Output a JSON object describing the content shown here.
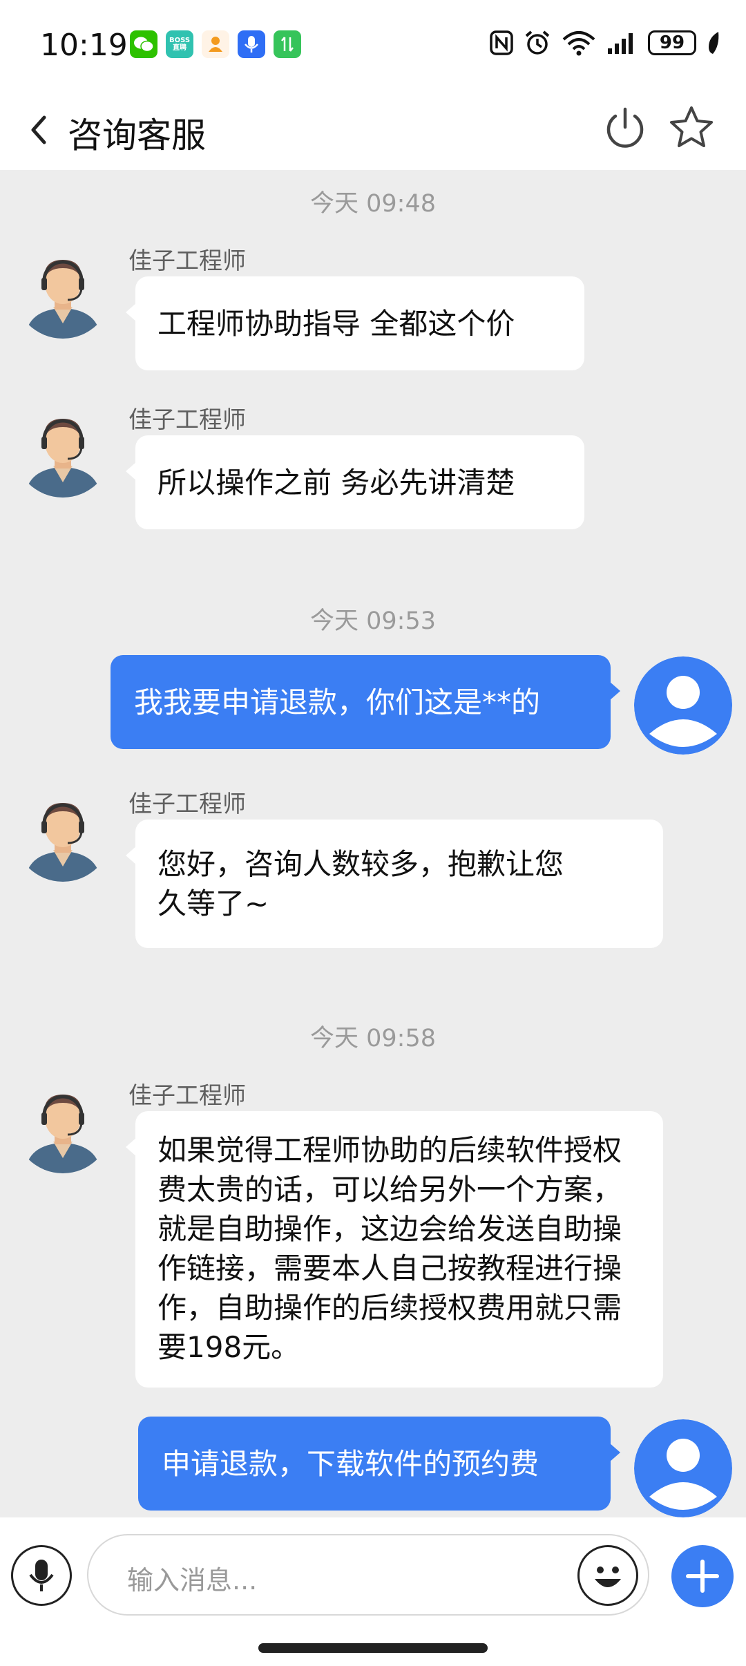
{
  "status_bar": {
    "time": "10:19",
    "battery": "99",
    "icons": [
      "wechat-icon",
      "boss-icon",
      "app-icon",
      "mic-app-icon",
      "transfer-icon",
      "nfc-icon",
      "alarm-icon",
      "wifi-icon",
      "signal-icon",
      "battery-icon",
      "leaf-icon"
    ]
  },
  "header": {
    "title": "咨询客服",
    "back_icon": "chevron-left-icon",
    "power_icon": "power-icon",
    "star_icon": "star-icon"
  },
  "messages": [
    {
      "type": "timestamp",
      "text": "今天 09:48"
    },
    {
      "type": "incoming",
      "sender": "佳子工程师",
      "text": "工程师协助指导 全都这个价"
    },
    {
      "type": "incoming",
      "sender": "佳子工程师",
      "text": "所以操作之前 务必先讲清楚"
    },
    {
      "type": "timestamp",
      "text": "今天 09:53"
    },
    {
      "type": "outgoing",
      "text": "我我要申请退款，你们这是**的"
    },
    {
      "type": "incoming",
      "sender": "佳子工程师",
      "lines": [
        "您好，咨询人数较多，抱歉让您",
        "久等了~"
      ]
    },
    {
      "type": "timestamp",
      "text": "今天 09:58"
    },
    {
      "type": "incoming",
      "sender": "佳子工程师",
      "lines": [
        "如果觉得工程师协助的后续软件授权",
        "费太贵的话，可以给另外一个方案，",
        "就是自助操作，这边会给发送自助操",
        "作链接，需要本人自己按教程进行操",
        "作，自助操作的后续授权费用就只需",
        "要198元。"
      ]
    },
    {
      "type": "outgoing",
      "text": "申请退款，下载软件的预约费"
    }
  ],
  "input": {
    "placeholder": "输入消息...",
    "mic_icon": "microphone-icon",
    "emoji_icon": "emoji-icon",
    "plus_icon": "plus-icon"
  },
  "colors": {
    "accent": "#3b7ef3",
    "background": "#ededed",
    "bubble_in": "#ffffff"
  }
}
